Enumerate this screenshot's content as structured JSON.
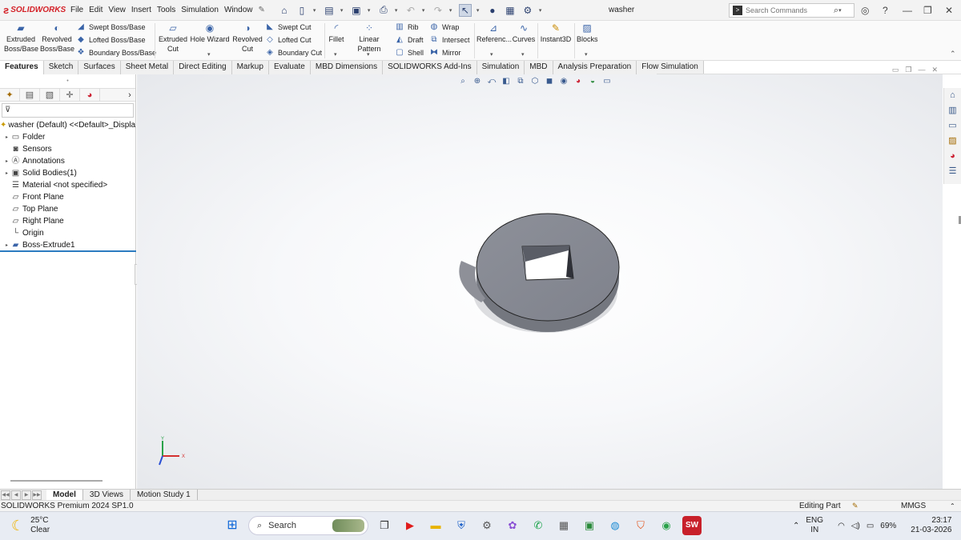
{
  "app": {
    "brand": "SOLIDWORKS",
    "document_title": "washer",
    "menus": [
      "File",
      "Edit",
      "View",
      "Insert",
      "Tools",
      "Simulation",
      "Window"
    ],
    "search_placeholder": "Search Commands"
  },
  "command_manager": {
    "extruded_boss_1": "Extruded",
    "extruded_boss_2": "Boss/Base",
    "revolved_boss_1": "Revolved",
    "revolved_boss_2": "Boss/Base",
    "swept_boss": "Swept Boss/Base",
    "lofted_boss": "Lofted Boss/Base",
    "boundary_boss": "Boundary Boss/Base",
    "extruded_cut_1": "Extruded",
    "extruded_cut_2": "Cut",
    "hole_wizard": "Hole Wizard",
    "revolved_cut_1": "Revolved",
    "revolved_cut_2": "Cut",
    "swept_cut": "Swept Cut",
    "lofted_cut": "Lofted Cut",
    "boundary_cut": "Boundary Cut",
    "fillet": "Fillet",
    "linear_pattern": "Linear Pattern",
    "rib": "Rib",
    "draft": "Draft",
    "shell": "Shell",
    "wrap": "Wrap",
    "intersect": "Intersect",
    "mirror": "Mirror",
    "reference": "Referenc...",
    "curves": "Curves",
    "instant3d": "Instant3D",
    "blocks": "Blocks"
  },
  "tabs": [
    "Features",
    "Sketch",
    "Surfaces",
    "Sheet Metal",
    "Direct Editing",
    "Markup",
    "Evaluate",
    "MBD Dimensions",
    "SOLIDWORKS Add-Ins",
    "Simulation",
    "MBD",
    "Analysis Preparation",
    "Flow Simulation"
  ],
  "feature_tree": {
    "root": "washer (Default) <<Default>_Display",
    "items": [
      {
        "label": "Folder",
        "expandable": true,
        "icon": "folder-icon"
      },
      {
        "label": "Sensors",
        "expandable": false,
        "icon": "sensor-icon"
      },
      {
        "label": "Annotations",
        "expandable": true,
        "icon": "annotations-icon"
      },
      {
        "label": "Solid Bodies(1)",
        "expandable": true,
        "icon": "solid-bodies-icon"
      },
      {
        "label": "Material <not specified>",
        "expandable": false,
        "icon": "material-icon"
      },
      {
        "label": "Front Plane",
        "expandable": false,
        "icon": "plane-icon"
      },
      {
        "label": "Top Plane",
        "expandable": false,
        "icon": "plane-icon"
      },
      {
        "label": "Right Plane",
        "expandable": false,
        "icon": "plane-icon"
      },
      {
        "label": "Origin",
        "expandable": false,
        "icon": "origin-icon"
      },
      {
        "label": "Boss-Extrude1",
        "expandable": true,
        "icon": "extrude-icon"
      }
    ]
  },
  "triad": {
    "y": "Y",
    "x": "X"
  },
  "bottom_tabs": [
    "Model",
    "3D Views",
    "Motion Study 1"
  ],
  "status": {
    "product": "SOLIDWORKS Premium 2024 SP1.0",
    "mode": "Editing Part",
    "units": "MMGS"
  },
  "taskbar": {
    "temperature": "25°C",
    "weather": "Clear",
    "search": "Search",
    "lang_1": "ENG",
    "lang_2": "IN",
    "battery": "69%",
    "time": "23:17",
    "date": "21-03-2026"
  },
  "colors": {
    "brand_red": "#d42027",
    "selection_blue": "#2c7bc0",
    "part_gray": "#8a8d96"
  }
}
